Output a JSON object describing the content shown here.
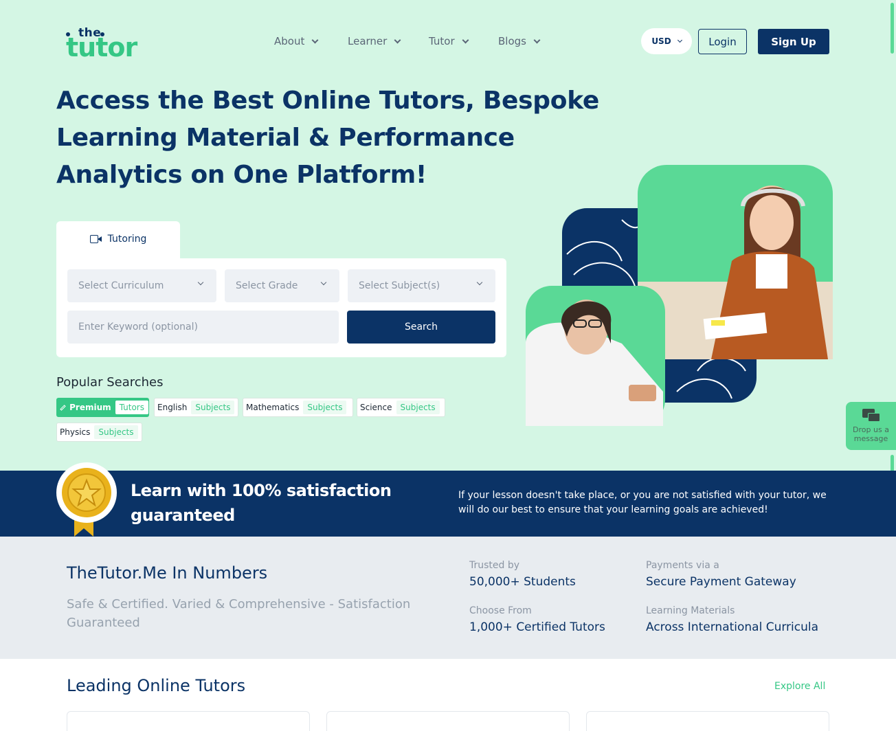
{
  "header": {
    "logo_top": "the",
    "logo_main": "tutor",
    "nav": [
      {
        "label": "About"
      },
      {
        "label": "Learner"
      },
      {
        "label": "Tutor"
      },
      {
        "label": "Blogs"
      }
    ],
    "currency": "USD",
    "login_label": "Login",
    "signup_label": "Sign Up"
  },
  "hero": {
    "headline": "Access the Best Online Tutors, Bespoke Learning Material & Performance Analytics on One Platform!"
  },
  "search": {
    "tab_label": "Tutoring",
    "curriculum_placeholder": "Select Curriculum",
    "grade_placeholder": "Select Grade",
    "subject_placeholder": "Select Subject(s)",
    "keyword_placeholder": "Enter Keyword (optional)",
    "search_label": "Search"
  },
  "popular": {
    "title": "Popular Searches",
    "chips": [
      {
        "label": "Premium",
        "tag": "Tutors"
      },
      {
        "label": "English",
        "tag": "Subjects"
      },
      {
        "label": "Mathematics",
        "tag": "Subjects"
      },
      {
        "label": "Science",
        "tag": "Subjects"
      },
      {
        "label": "Physics",
        "tag": "Subjects"
      }
    ]
  },
  "chat_widget": {
    "label": "Drop us a message",
    "icon": "chat-bubbles-icon"
  },
  "guarantee": {
    "title": "Learn with 100% satisfaction guaranteed",
    "text": "If your lesson doesn't take place, or you are not satisfied with your tutor, we will do our best to ensure that your learning goals are achieved!"
  },
  "numbers": {
    "title": "TheTutor.Me In Numbers",
    "subtitle": "Safe & Certified. Varied & Comprehensive - Satisfaction Guaranteed",
    "stats": [
      {
        "label": "Trusted by",
        "value": "50,000+ Students"
      },
      {
        "label": "Payments via a",
        "value": "Secure Payment Gateway"
      },
      {
        "label": "Choose From",
        "value": "1,000+ Certified Tutors"
      },
      {
        "label": "Learning Materials",
        "value": "Across International Curricula"
      }
    ]
  },
  "leading": {
    "title": "Leading Online Tutors",
    "explore_label": "Explore All"
  },
  "colors": {
    "hero_bg": "#d4f6e4",
    "navy": "#0b3366",
    "accent_green": "#35c785",
    "numbers_bg": "#e8ecf0"
  }
}
